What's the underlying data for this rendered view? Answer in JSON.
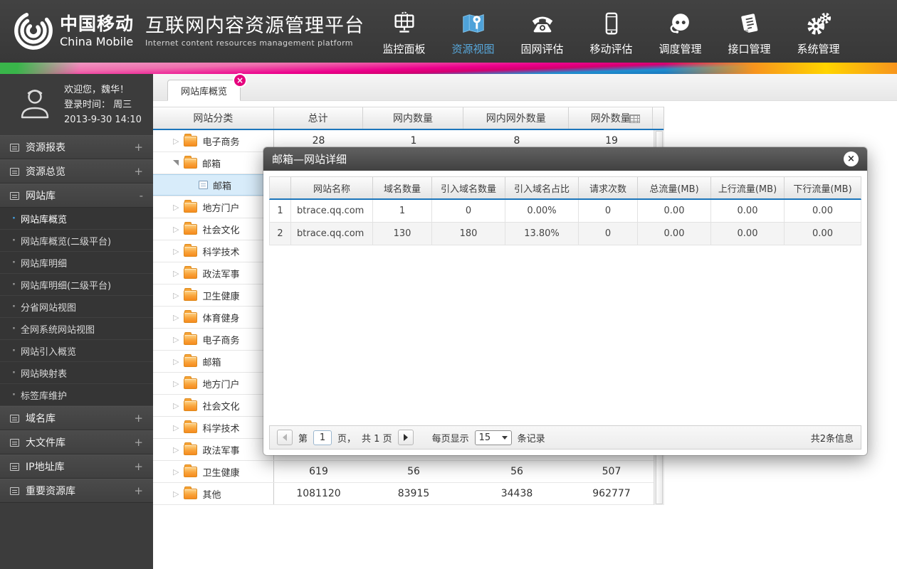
{
  "colors": {
    "accent_blue": "#1b75bb",
    "nav_active_blue": "#58a8dc",
    "tab_close_pink": "#e5007d",
    "folder_orange": "#f6921f",
    "selected_row_blue": "#d8ecfa",
    "header_dark": "#3c3c3c"
  },
  "header": {
    "brand_zh": "中国移动",
    "brand_en": "China Mobile",
    "platform_title": "互联网内容资源管理平台",
    "platform_subtitle": "Internet content resources management platform",
    "nav": [
      {
        "label": "监控面板",
        "icon": "dashboard-icon",
        "active": false
      },
      {
        "label": "资源视图",
        "icon": "map-icon",
        "active": true
      },
      {
        "label": "固网评估",
        "icon": "phone-icon",
        "active": false
      },
      {
        "label": "移动评估",
        "icon": "mobile-icon",
        "active": false
      },
      {
        "label": "调度管理",
        "icon": "headset-icon",
        "active": false
      },
      {
        "label": "接口管理",
        "icon": "document-icon",
        "active": false
      },
      {
        "label": "系统管理",
        "icon": "gears-icon",
        "active": false
      }
    ]
  },
  "sidebar": {
    "welcome": "欢迎您，魏华！",
    "login_label": "登录时间： 周三",
    "login_time": "2013-9-30  14:10",
    "menu": [
      {
        "label": "资源报表",
        "toggle": "+"
      },
      {
        "label": "资源总览",
        "toggle": "+"
      },
      {
        "label": "网站库",
        "toggle": "-",
        "expanded": true,
        "active_child": 0,
        "children": [
          "网站库概览",
          "网站库概览(二级平台)",
          "网站库明细",
          "网站库明细(二级平台)",
          "分省网站视图",
          "全网系统网站视图",
          "网站引入概览",
          "网站映射表",
          "标签库维护"
        ]
      },
      {
        "label": "域名库",
        "toggle": "+"
      },
      {
        "label": "大文件库",
        "toggle": "+"
      },
      {
        "label": "IP地址库",
        "toggle": "+"
      },
      {
        "label": "重要资源库",
        "toggle": "+"
      }
    ]
  },
  "main": {
    "tab_label": "网站库概览",
    "grid": {
      "headers": [
        "网站分类",
        "总计",
        "网内数量",
        "网内网外数量",
        "网外数量"
      ],
      "rows": [
        {
          "label": "电子商务",
          "node": "collapsed",
          "level": 0,
          "selected": false,
          "values": [
            "28",
            "1",
            "8",
            "19"
          ]
        },
        {
          "label": "邮箱",
          "node": "expanded",
          "level": 0,
          "selected": false,
          "values": [
            "",
            "",
            "",
            ""
          ]
        },
        {
          "label": "邮箱",
          "node": "leaf",
          "level": 1,
          "selected": true,
          "values": [
            "",
            "",
            "",
            ""
          ]
        },
        {
          "label": "地方门户",
          "node": "collapsed",
          "level": 0,
          "selected": false,
          "values": [
            "",
            "",
            "",
            ""
          ]
        },
        {
          "label": "社会文化",
          "node": "collapsed",
          "level": 0,
          "selected": false,
          "values": [
            "",
            "",
            "",
            ""
          ]
        },
        {
          "label": "科学技术",
          "node": "collapsed",
          "level": 0,
          "selected": false,
          "values": [
            "",
            "",
            "",
            ""
          ]
        },
        {
          "label": "政法军事",
          "node": "collapsed",
          "level": 0,
          "selected": false,
          "values": [
            "",
            "",
            "",
            ""
          ]
        },
        {
          "label": "卫生健康",
          "node": "collapsed",
          "level": 0,
          "selected": false,
          "values": [
            "",
            "",
            "",
            ""
          ]
        },
        {
          "label": "体育健身",
          "node": "collapsed",
          "level": 0,
          "selected": false,
          "values": [
            "",
            "",
            "",
            ""
          ]
        },
        {
          "label": "电子商务",
          "node": "collapsed",
          "level": 0,
          "selected": false,
          "values": [
            "",
            "",
            "",
            ""
          ]
        },
        {
          "label": "邮箱",
          "node": "collapsed",
          "level": 0,
          "selected": false,
          "values": [
            "",
            "",
            "",
            ""
          ]
        },
        {
          "label": "地方门户",
          "node": "collapsed",
          "level": 0,
          "selected": false,
          "values": [
            "",
            "",
            "",
            ""
          ]
        },
        {
          "label": "社会文化",
          "node": "collapsed",
          "level": 0,
          "selected": false,
          "values": [
            "",
            "",
            "",
            ""
          ]
        },
        {
          "label": "科学技术",
          "node": "collapsed",
          "level": 0,
          "selected": false,
          "values": [
            "",
            "",
            "",
            ""
          ]
        },
        {
          "label": "政法军事",
          "node": "collapsed",
          "level": 0,
          "selected": false,
          "values": [
            "",
            "",
            "",
            ""
          ]
        },
        {
          "label": "卫生健康",
          "node": "collapsed",
          "level": 0,
          "selected": false,
          "values": [
            "619",
            "56",
            "56",
            "507"
          ]
        },
        {
          "label": "其他",
          "node": "collapsed",
          "level": 0,
          "selected": false,
          "values": [
            "1081120",
            "83915",
            "34438",
            "962777"
          ]
        }
      ]
    }
  },
  "modal": {
    "title": "邮箱—网站详细",
    "table": {
      "headers": [
        "",
        "网站名称",
        "域名数量",
        "引入域名数量",
        "引入域名占比",
        "请求次数",
        "总流量(MB)",
        "上行流量(MB)",
        "下行流量(MB)"
      ],
      "rows": [
        [
          "1",
          "btrace.qq.com",
          "1",
          "0",
          "0.00%",
          "0",
          "0.00",
          "0.00",
          "0.00"
        ],
        [
          "2",
          "btrace.qq.com",
          "130",
          "180",
          "13.80%",
          "0",
          "0.00",
          "0.00",
          "0.00"
        ]
      ]
    },
    "pagination": {
      "page_prefix": "第",
      "page_value": "1",
      "page_suffix": "页，",
      "total_pages": "共 1 页",
      "per_page_label": "每页显示",
      "per_page_value": "15",
      "per_page_suffix": "条记录",
      "total_info": "共2条信息"
    }
  }
}
